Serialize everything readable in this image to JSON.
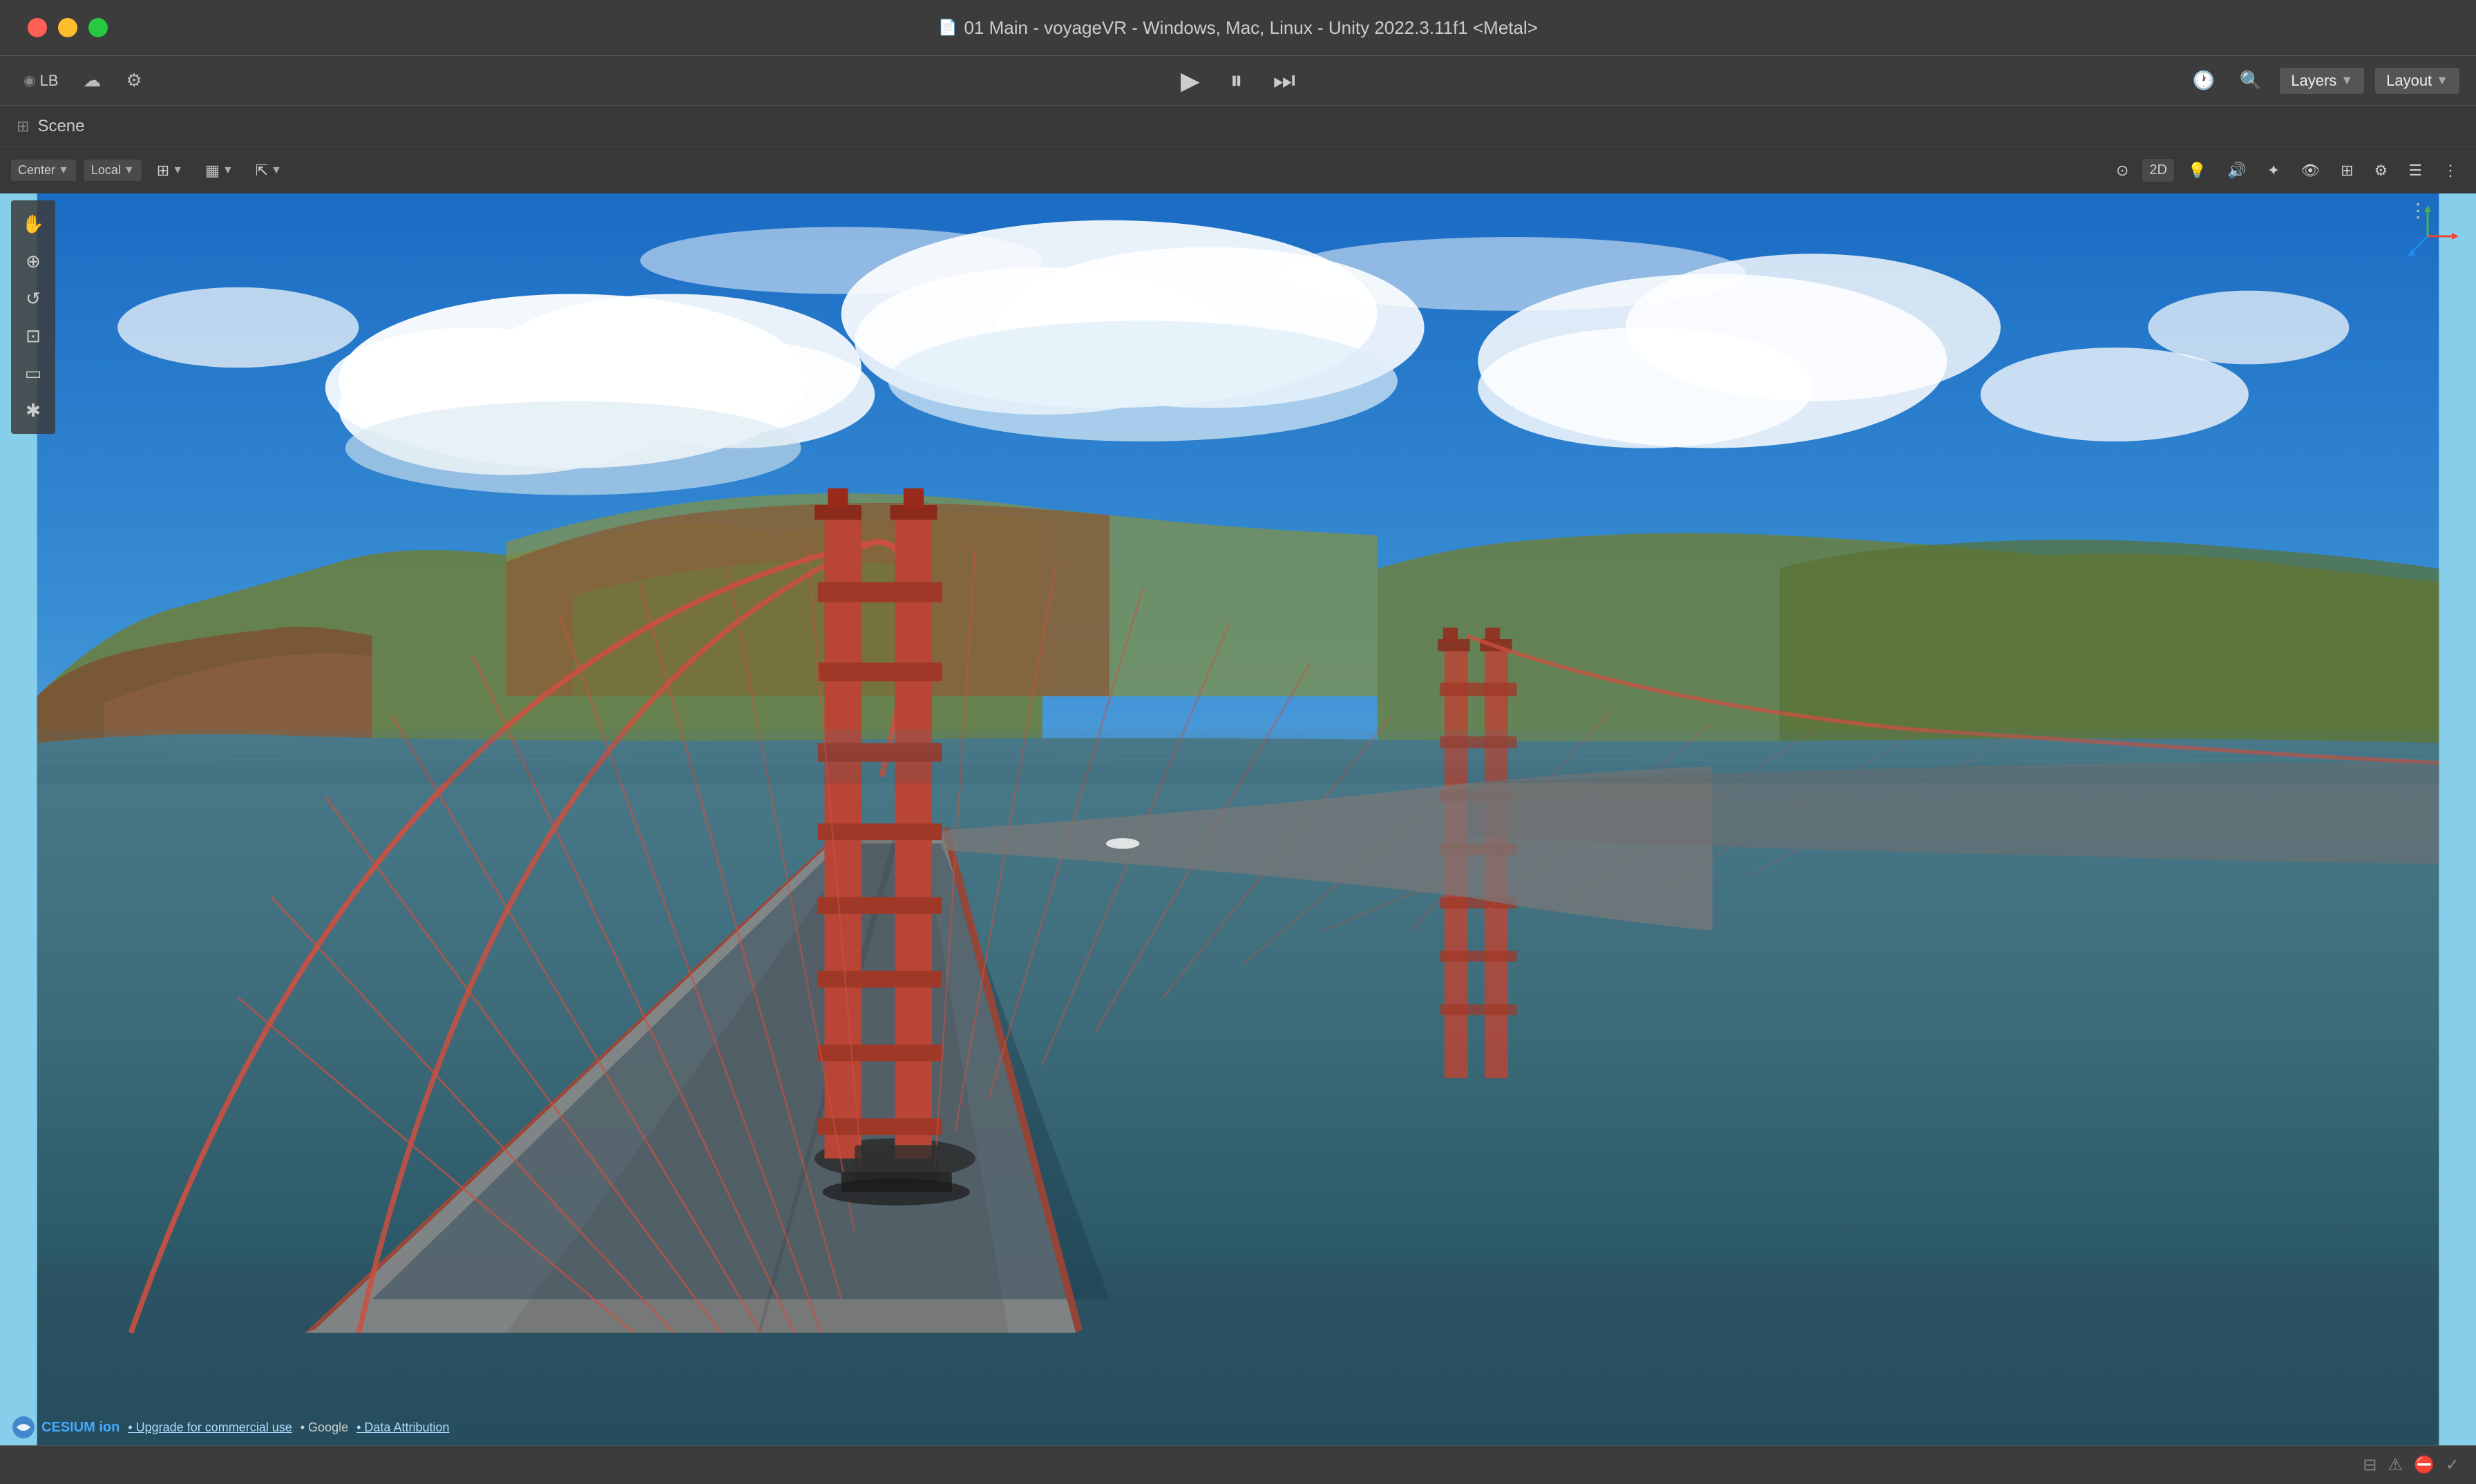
{
  "window": {
    "title": "01 Main - voyageVR - Windows, Mac, Linux - Unity 2022.3.11f1 <Metal>",
    "title_icon": "📄"
  },
  "traffic_lights": {
    "red": "#ff5f57",
    "yellow": "#ffbd2e",
    "green": "#28c840"
  },
  "toolbar": {
    "left_items": [
      {
        "label": "LB",
        "id": "lb-btn"
      },
      {
        "label": "☁",
        "id": "cloud-btn"
      },
      {
        "label": "⚙",
        "id": "settings-btn"
      }
    ],
    "play": "▶",
    "pause": "⏸",
    "step": "⏭",
    "right_items": [
      {
        "label": "🕐",
        "id": "history-btn"
      },
      {
        "label": "🔍",
        "id": "search-btn"
      },
      {
        "label": "Layers",
        "id": "layers-btn"
      },
      {
        "label": "▼",
        "id": "layers-dropdown"
      },
      {
        "label": "Layout",
        "id": "layout-btn"
      },
      {
        "label": "▼",
        "id": "layout-dropdown"
      }
    ]
  },
  "scene_panel": {
    "label": "Scene",
    "scene_icon": "⊞"
  },
  "scene_toolbar": {
    "left": [
      {
        "label": "Center",
        "has_dropdown": true,
        "id": "center-btn"
      },
      {
        "label": "Local",
        "has_dropdown": true,
        "id": "local-btn"
      },
      {
        "label": "⊞",
        "id": "grid-btn"
      },
      {
        "label": "▦",
        "id": "snap-btn"
      },
      {
        "label": "↗",
        "id": "transform-btn"
      }
    ],
    "right": [
      {
        "label": "⊙",
        "id": "persp-btn"
      },
      {
        "label": "2D",
        "id": "2d-btn"
      },
      {
        "label": "💡",
        "id": "light-btn"
      },
      {
        "label": "🔊",
        "id": "audio-btn"
      },
      {
        "label": "✦",
        "id": "fx-btn"
      },
      {
        "label": "👁",
        "id": "view-btn"
      },
      {
        "label": "⊞",
        "id": "overlay-btn"
      },
      {
        "label": "⚙",
        "id": "scene-settings-btn"
      },
      {
        "label": "☰",
        "id": "gizmo-btn"
      },
      {
        "label": "≡",
        "id": "dots-btn"
      }
    ]
  },
  "left_tools": [
    {
      "icon": "✋",
      "label": "Hand",
      "id": "hand-tool",
      "active": false
    },
    {
      "icon": "⊕",
      "label": "Move",
      "id": "move-tool",
      "active": false
    },
    {
      "icon": "↺",
      "label": "Rotate",
      "id": "rotate-tool",
      "active": false
    },
    {
      "icon": "⊡",
      "label": "Scale",
      "id": "scale-tool",
      "active": false
    },
    {
      "icon": "⬡",
      "label": "Rect",
      "id": "rect-tool",
      "active": false
    },
    {
      "icon": "✱",
      "label": "Transform",
      "id": "transform-tool",
      "active": false
    }
  ],
  "attribution": {
    "cesium_text": "CESIUM ion",
    "upgrade_link": "• Upgrade for commercial use",
    "google_text": "• Google",
    "data_attr": "• Data Attribution"
  },
  "status_bar": {
    "icons": [
      "collapse-icon",
      "warning-icon",
      "error-icon",
      "check-icon"
    ]
  }
}
